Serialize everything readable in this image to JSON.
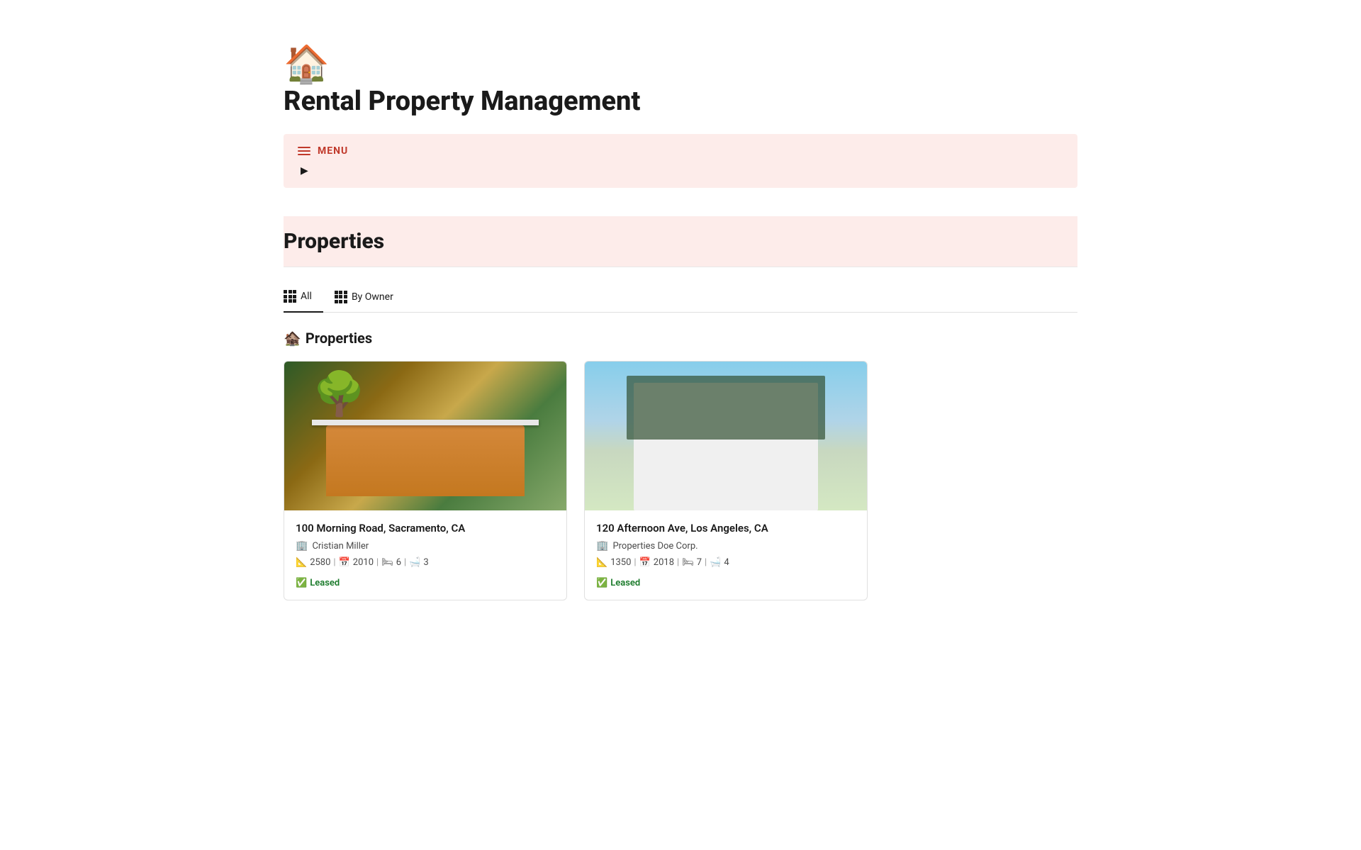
{
  "app": {
    "icon": "🏠",
    "title": "Rental Property Management"
  },
  "menu": {
    "label": "MENU",
    "arrow": "▶"
  },
  "properties_section": {
    "title": "Properties"
  },
  "tabs": [
    {
      "id": "all",
      "label": "All",
      "active": true
    },
    {
      "id": "by-owner",
      "label": "By Owner",
      "active": false
    }
  ],
  "subsection": {
    "icon": "🏚️",
    "title": "Properties"
  },
  "properties": [
    {
      "id": 1,
      "address": "100 Morning Road, Sacramento, CA",
      "owner_icon": "🏢",
      "owner": "Cristian Miller",
      "sqft": "2580",
      "year": "2010",
      "beds": "6",
      "baths": "3",
      "status": "Leased",
      "status_icon": "✅",
      "image_type": "house-1"
    },
    {
      "id": 2,
      "address": "120 Afternoon Ave, Los Angeles, CA",
      "owner_icon": "🏢",
      "owner": "Properties Doe Corp.",
      "sqft": "1350",
      "year": "2018",
      "beds": "7",
      "baths": "4",
      "status": "Leased",
      "status_icon": "✅",
      "image_type": "house-2"
    }
  ],
  "icons": {
    "sqft": "📐",
    "year": "📅",
    "bed": "🛏",
    "bath": "🛁"
  }
}
